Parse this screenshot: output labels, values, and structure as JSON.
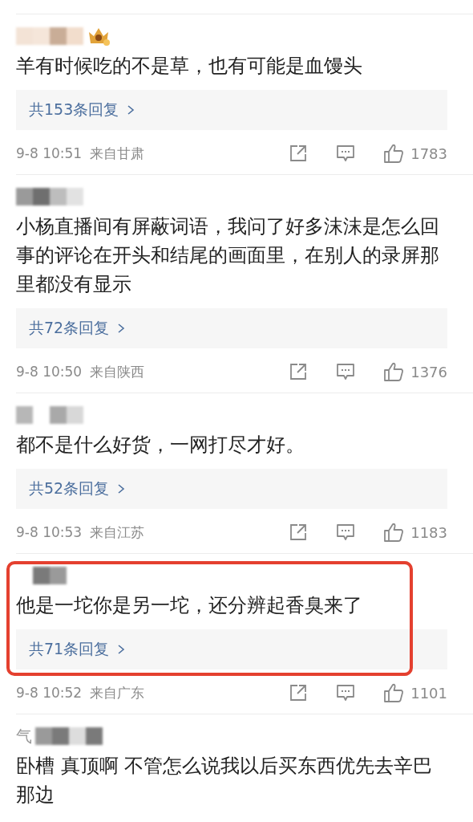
{
  "comments": [
    {
      "badge": true,
      "highlighted": false,
      "text": "羊有时候吃的不是草，也有可能是血馒头",
      "replies": "共153条回复",
      "time": "9-8 10:51",
      "location": "来自甘肃",
      "likes": "1783"
    },
    {
      "badge": false,
      "highlighted": false,
      "text": "小杨直播间有屏蔽词语，我问了好多沫沫是怎么回事的评论在开头和结尾的画面里，在别人的录屏那里都没有显示",
      "replies": "共72条回复",
      "time": "9-8 10:50",
      "location": "来自陕西",
      "likes": "1376"
    },
    {
      "badge": false,
      "highlighted": false,
      "text": "都不是什么好货，一网打尽才好。",
      "replies": "共52条回复",
      "time": "9-8 10:53",
      "location": "来自江苏",
      "likes": "1183"
    },
    {
      "badge": false,
      "highlighted": true,
      "text": "他是一坨你是另一坨，还分辨起香臭来了",
      "replies": "共71条回复",
      "time": "9-8 10:52",
      "location": "来自广东",
      "likes": "1101"
    },
    {
      "name_prefix": "气",
      "badge": false,
      "highlighted": false,
      "text": "卧槽 真顶啊 不管怎么说我以后买东西优先去辛巴那边"
    }
  ]
}
